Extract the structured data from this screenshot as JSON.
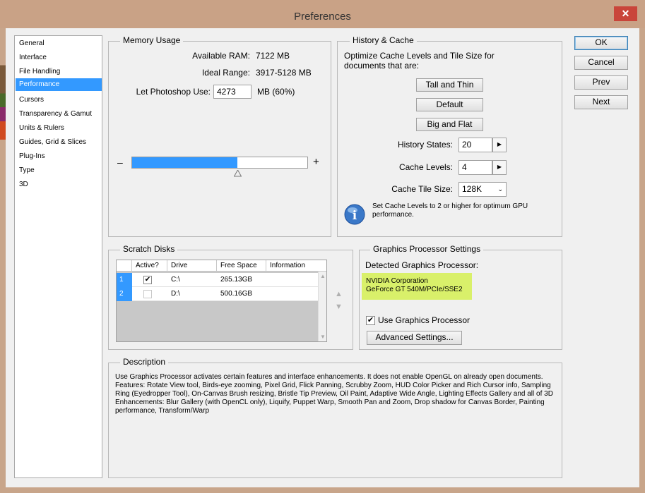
{
  "window": {
    "title": "Preferences",
    "close_glyph": "✕"
  },
  "sidebar": {
    "items": [
      {
        "label": "General",
        "selected": false
      },
      {
        "label": "Interface",
        "selected": false
      },
      {
        "label": "File Handling",
        "selected": false
      },
      {
        "label": "Performance",
        "selected": true
      },
      {
        "label": "Cursors",
        "selected": false
      },
      {
        "label": "Transparency & Gamut",
        "selected": false
      },
      {
        "label": "Units & Rulers",
        "selected": false
      },
      {
        "label": "Guides, Grid & Slices",
        "selected": false
      },
      {
        "label": "Plug-Ins",
        "selected": false
      },
      {
        "label": "Type",
        "selected": false
      },
      {
        "label": "3D",
        "selected": false
      }
    ]
  },
  "memory": {
    "title": "Memory Usage",
    "available_label": "Available RAM:",
    "available_value": "7122 MB",
    "ideal_label": "Ideal Range:",
    "ideal_value": "3917-5128 MB",
    "let_label": "Let Photoshop Use:",
    "let_value": "4273",
    "let_unit": "MB (60%)",
    "slider_fraction": 0.6,
    "minus": "–",
    "plus": "+"
  },
  "history": {
    "title": "History & Cache",
    "desc": "Optimize Cache Levels and Tile Size for documents that are:",
    "btn_tall": "Tall and Thin",
    "btn_default": "Default",
    "btn_big": "Big and Flat",
    "states_label": "History States:",
    "states_value": "20",
    "levels_label": "Cache Levels:",
    "levels_value": "4",
    "tile_label": "Cache Tile Size:",
    "tile_value": "128K",
    "info": "Set Cache Levels to 2 or higher for optimum GPU performance."
  },
  "buttons": {
    "ok": "OK",
    "cancel": "Cancel",
    "prev": "Prev",
    "next": "Next"
  },
  "scratch": {
    "title": "Scratch Disks",
    "headers": [
      "Active?",
      "Drive",
      "Free Space",
      "Information"
    ],
    "rows": [
      {
        "num": "1",
        "active": true,
        "drive": "C:\\",
        "free": "265.13GB",
        "info": ""
      },
      {
        "num": "2",
        "active": false,
        "drive": "D:\\",
        "free": "500.16GB",
        "info": ""
      }
    ]
  },
  "gpu": {
    "title": "Graphics Processor Settings",
    "detected_label": "Detected Graphics Processor:",
    "detected_line1": "NVIDIA Corporation",
    "detected_line2": "GeForce GT 540M/PCIe/SSE2",
    "use_label": "Use Graphics Processor",
    "use_checked": true,
    "advanced": "Advanced Settings..."
  },
  "description": {
    "title": "Description",
    "line1": "Use Graphics Processor activates certain features and interface enhancements. It does not enable OpenGL on already open documents.",
    "line2": "Features: Rotate View tool, Birds-eye zooming, Pixel Grid, Flick Panning, Scrubby Zoom, HUD Color Picker and Rich Cursor info, Sampling Ring (Eyedropper Tool), On-Canvas Brush resizing, Bristle Tip Preview, Oil Paint, Adaptive Wide Angle, Lighting Effects Gallery and all of 3D",
    "line3": "Enhancements: Blur Gallery (with OpenCL only), Liquify, Puppet Warp, Smooth Pan and Zoom, Drop shadow for Canvas Border, Painting performance, Transform/Warp"
  },
  "colors": {
    "selection": "#3399ff",
    "gpu_highlight": "#d9f06a",
    "titlebar": "#c9a286",
    "close": "#c9453a"
  }
}
